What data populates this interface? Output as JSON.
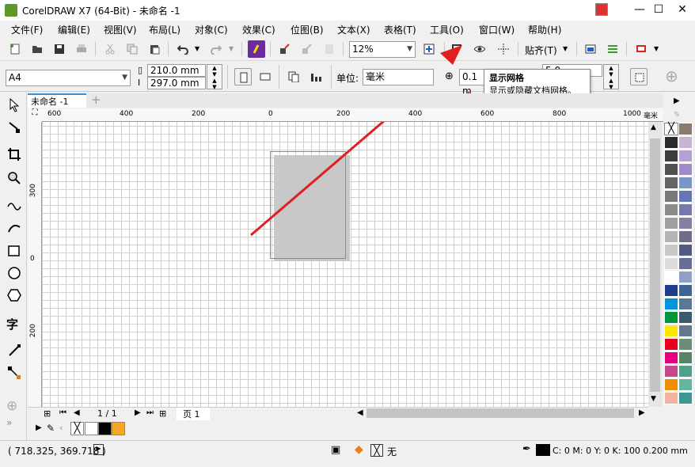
{
  "window": {
    "title": "CorelDRAW X7 (64-Bit) - 未命名 -1",
    "minimize": "—",
    "maximize": "☐",
    "close": "✕"
  },
  "menu": [
    "文件(F)",
    "编辑(E)",
    "视图(V)",
    "布局(L)",
    "对象(C)",
    "效果(C)",
    "位图(B)",
    "文本(X)",
    "表格(T)",
    "工具(O)",
    "窗口(W)",
    "帮助(H)"
  ],
  "toolbar": {
    "zoom_value": "12%",
    "snap_label": "贴齐(T)"
  },
  "property_bar": {
    "page_size": "A4",
    "width": "210.0 mm",
    "height": "297.0 mm",
    "units_label": "单位:",
    "units_value": "毫米",
    "nudge_value": "0.1 m",
    "dup_value": "5.0"
  },
  "tooltip": {
    "title": "显示网格",
    "description": "显示或隐藏文档网格。"
  },
  "document_tab": "未命名 -1",
  "ruler": {
    "h_ticks": [
      "600",
      "400",
      "200",
      "0",
      "200",
      "400",
      "600",
      "800",
      "1000",
      "毫米"
    ],
    "v_ticks": [
      "300",
      "0",
      "200"
    ]
  },
  "page_nav": {
    "counter": "1 / 1",
    "page_tab": "页 1"
  },
  "status": {
    "coords": "( 718.325, 369.718 )",
    "fill_label": "无",
    "outline_info": "C: 0 M: 0 Y: 0 K: 100  0.200 mm"
  },
  "palette_colors": [
    "#2a2a2a",
    "#3c3c3c",
    "#505050",
    "#646464",
    "#787878",
    "#8c8c8c",
    "#a0a0a0",
    "#b4b4b4",
    "#c8c8c8",
    "#dcdcdc",
    "#ffffff",
    "#1e3c8c",
    "#0096dc",
    "#00963c",
    "#ffe600",
    "#e6001e",
    "#e6007e",
    "#c8468c",
    "#f08c00",
    "#f0b4a0"
  ],
  "palette_colors_right": [
    "#8c7a6e",
    "#c8b4d2",
    "#b4a0d2",
    "#a08cc8",
    "#7896c8",
    "#6478b4",
    "#7878aa",
    "#8282a0",
    "#6e6e8c",
    "#505a82",
    "#646e96",
    "#8ca0c8",
    "#3c6496",
    "#5a7896",
    "#3c5a6e",
    "#64788c",
    "#6e8c78",
    "#5a8264",
    "#50a08c",
    "#64b4a0",
    "#3c9696"
  ],
  "doc_palette_colors": [
    "#ffffff",
    "#000000",
    "#f5a623"
  ],
  "accent_color": "#e02020"
}
